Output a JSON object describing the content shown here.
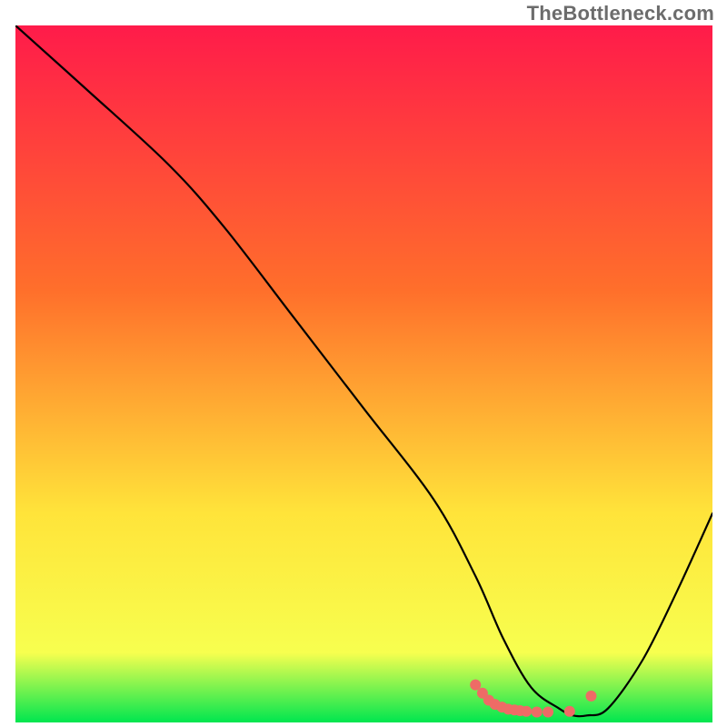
{
  "attribution": "TheBottleneck.com",
  "chart_data": {
    "type": "line",
    "xlabel": "",
    "ylabel": "",
    "xlim": [
      0,
      100
    ],
    "ylim": [
      0,
      100
    ],
    "grid": false,
    "gradient": {
      "top": "#ff1b4a",
      "mid1": "#ff6f2b",
      "mid2": "#ffe43a",
      "mid3": "#f7ff4f",
      "bottom": "#00e64f"
    },
    "series": [
      {
        "name": "curve",
        "color": "#000000",
        "x": [
          0,
          10,
          22,
          30,
          40,
          50,
          60,
          66,
          70,
          74,
          78,
          80,
          82,
          85,
          90,
          95,
          100
        ],
        "y": [
          100,
          91,
          80,
          71,
          58,
          45,
          32,
          21,
          12,
          5,
          2,
          1,
          1,
          2,
          9,
          19,
          30
        ]
      }
    ],
    "markers": [
      {
        "x": 66.0,
        "y": 5.4
      },
      {
        "x": 67.0,
        "y": 4.2
      },
      {
        "x": 67.9,
        "y": 3.2
      },
      {
        "x": 68.8,
        "y": 2.6
      },
      {
        "x": 69.8,
        "y": 2.2
      },
      {
        "x": 70.7,
        "y": 1.9
      },
      {
        "x": 71.6,
        "y": 1.8
      },
      {
        "x": 72.4,
        "y": 1.7
      },
      {
        "x": 73.3,
        "y": 1.6
      },
      {
        "x": 74.8,
        "y": 1.5
      },
      {
        "x": 76.4,
        "y": 1.5
      },
      {
        "x": 79.5,
        "y": 1.6
      },
      {
        "x": 82.6,
        "y": 3.8
      }
    ],
    "marker_style": {
      "color": "#ee6b66",
      "radius_px": 6
    }
  }
}
